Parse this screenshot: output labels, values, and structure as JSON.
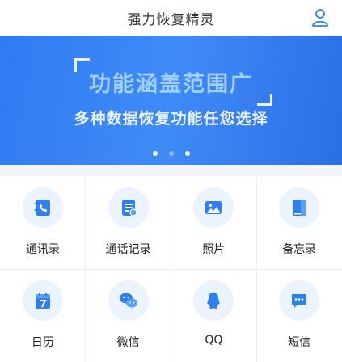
{
  "header": {
    "title": "强力恢复精灵",
    "user_icon": "user-icon"
  },
  "banner": {
    "headline": "功能涵盖范围广",
    "subline": "多种数据恢复功能任您选择",
    "page_count": 3,
    "active_page": 2
  },
  "features": [
    {
      "label": "通讯录",
      "icon": "contacts-icon"
    },
    {
      "label": "通话记录",
      "icon": "call-log-icon"
    },
    {
      "label": "照片",
      "icon": "photo-icon"
    },
    {
      "label": "备忘录",
      "icon": "memo-icon"
    },
    {
      "label": "日历",
      "icon": "calendar-icon"
    },
    {
      "label": "微信",
      "icon": "wechat-icon"
    },
    {
      "label": "QQ",
      "icon": "qq-icon"
    },
    {
      "label": "短信",
      "icon": "sms-icon"
    }
  ],
  "colors": {
    "accent": "#2f80ef",
    "icon_bg": "#eaf3ff"
  }
}
